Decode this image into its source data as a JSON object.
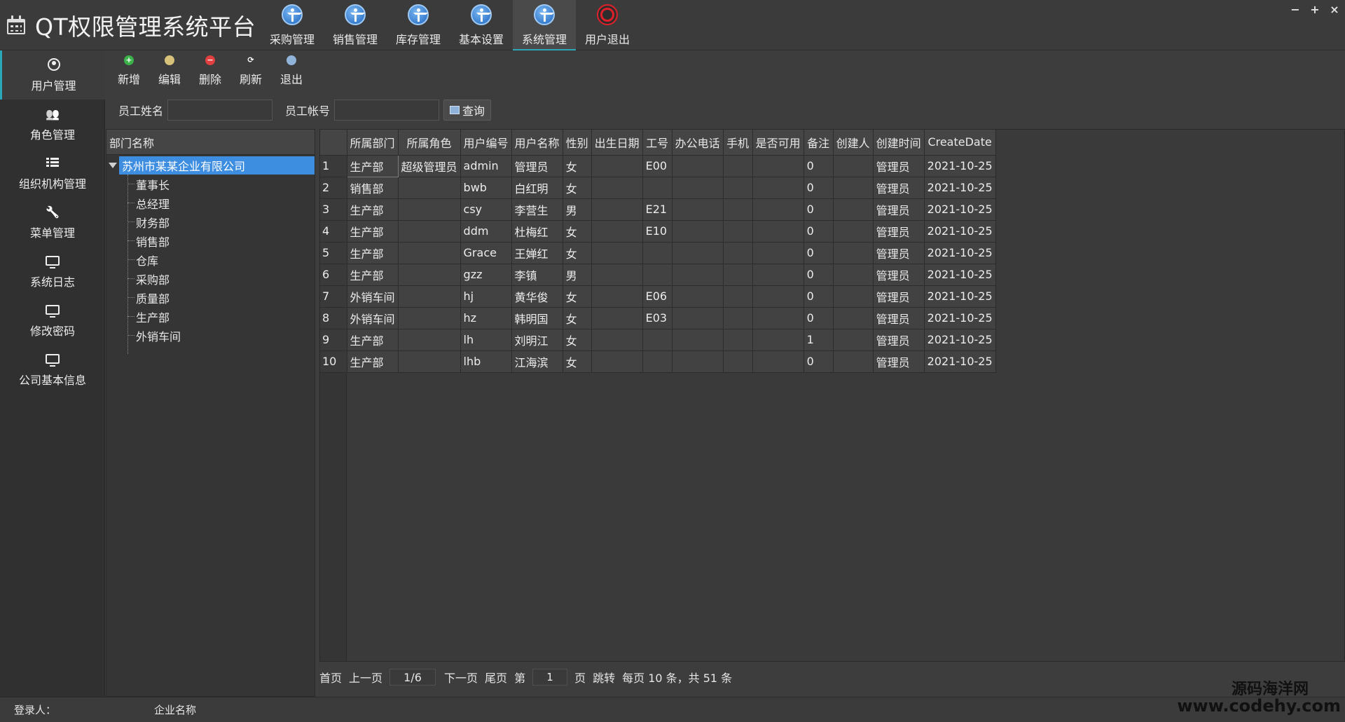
{
  "app": {
    "title": "QT权限管理系统平台"
  },
  "topnav": [
    {
      "label": "采购管理",
      "icon": "accessibility-icon"
    },
    {
      "label": "销售管理",
      "icon": "accessibility-icon"
    },
    {
      "label": "库存管理",
      "icon": "accessibility-icon"
    },
    {
      "label": "基本设置",
      "icon": "accessibility-icon"
    },
    {
      "label": "系统管理",
      "icon": "accessibility-icon",
      "active": true
    },
    {
      "label": "用户退出",
      "icon": "power-icon"
    }
  ],
  "window_controls": {
    "minimize": "−",
    "maximize": "+",
    "close": "×"
  },
  "sidebar": [
    {
      "label": "用户管理",
      "icon": "user-circle-icon",
      "active": true
    },
    {
      "label": "角色管理",
      "icon": "users-icon"
    },
    {
      "label": "组织机构管理",
      "icon": "list-icon"
    },
    {
      "label": "菜单管理",
      "icon": "wrench-icon"
    },
    {
      "label": "系统日志",
      "icon": "monitor-icon"
    },
    {
      "label": "修改密码",
      "icon": "monitor-icon"
    },
    {
      "label": "公司基本信息",
      "icon": "monitor-icon"
    }
  ],
  "toolbar": {
    "add": "新增",
    "edit": "编辑",
    "delete": "删除",
    "refresh": "刷新",
    "exit": "退出"
  },
  "search": {
    "name_label": "员工姓名",
    "name_value": "",
    "account_label": "员工帐号",
    "account_value": "",
    "query_button": "查询"
  },
  "tree": {
    "header": "部门名称",
    "root": "苏州市某某企业有限公司",
    "children": [
      "董事长",
      "总经理",
      "财务部",
      "销售部",
      "仓库",
      "采购部",
      "质量部",
      "生产部",
      "外销车间"
    ]
  },
  "grid": {
    "columns": [
      "所属部门",
      "所属角色",
      "用户编号",
      "用户名称",
      "性别",
      "出生日期",
      "工号",
      "办公电话",
      "手机",
      "是否可用",
      "备注",
      "创建人",
      "创建时间",
      "CreateDate"
    ],
    "rows": [
      [
        "1",
        "生产部",
        "超级管理员",
        "admin",
        "管理员",
        "女",
        "",
        "E00",
        "",
        "",
        "",
        "0",
        "",
        "管理员",
        "2021-10-25"
      ],
      [
        "2",
        "销售部",
        "",
        "bwb",
        "白红明",
        "女",
        "",
        "",
        "",
        "",
        "",
        "0",
        "",
        "管理员",
        "2021-10-25"
      ],
      [
        "3",
        "生产部",
        "",
        "csy",
        "李营生",
        "男",
        "",
        "E21",
        "",
        "",
        "",
        "0",
        "",
        "管理员",
        "2021-10-25"
      ],
      [
        "4",
        "生产部",
        "",
        "ddm",
        "杜梅红",
        "女",
        "",
        "E10",
        "",
        "",
        "",
        "0",
        "",
        "管理员",
        "2021-10-25"
      ],
      [
        "5",
        "生产部",
        "",
        "Grace",
        "王婵红",
        "女",
        "",
        "",
        "",
        "",
        "",
        "0",
        "",
        "管理员",
        "2021-10-25"
      ],
      [
        "6",
        "生产部",
        "",
        "gzz",
        "李镇",
        "男",
        "",
        "",
        "",
        "",
        "",
        "0",
        "",
        "管理员",
        "2021-10-25"
      ],
      [
        "7",
        "外销车间",
        "",
        "hj",
        "黄华俊",
        "女",
        "",
        "E06",
        "",
        "",
        "",
        "0",
        "",
        "管理员",
        "2021-10-25"
      ],
      [
        "8",
        "外销车间",
        "",
        "hz",
        "韩明国",
        "女",
        "",
        "E03",
        "",
        "",
        "",
        "0",
        "",
        "管理员",
        "2021-10-25"
      ],
      [
        "9",
        "生产部",
        "",
        "lh",
        "刘明江",
        "女",
        "",
        "",
        "",
        "",
        "",
        "1",
        "",
        "管理员",
        "2021-10-25"
      ],
      [
        "10",
        "生产部",
        "",
        "lhb",
        "江海滨",
        "女",
        "",
        "",
        "",
        "",
        "",
        "0",
        "",
        "管理员",
        "2021-10-25"
      ]
    ]
  },
  "pager": {
    "first": "首页",
    "prev": "上一页",
    "page_display": "1/6",
    "next": "下一页",
    "last": "尾页",
    "goto_prefix": "第",
    "goto_value": "1",
    "goto_suffix": "页",
    "jump": "跳转",
    "summary": "每页 10 条，共 51 条"
  },
  "status": {
    "login_label": "登录人：",
    "company_label": "企业名称"
  },
  "watermark": {
    "line1": "源码海洋网",
    "line2": "www.codehy.com"
  }
}
